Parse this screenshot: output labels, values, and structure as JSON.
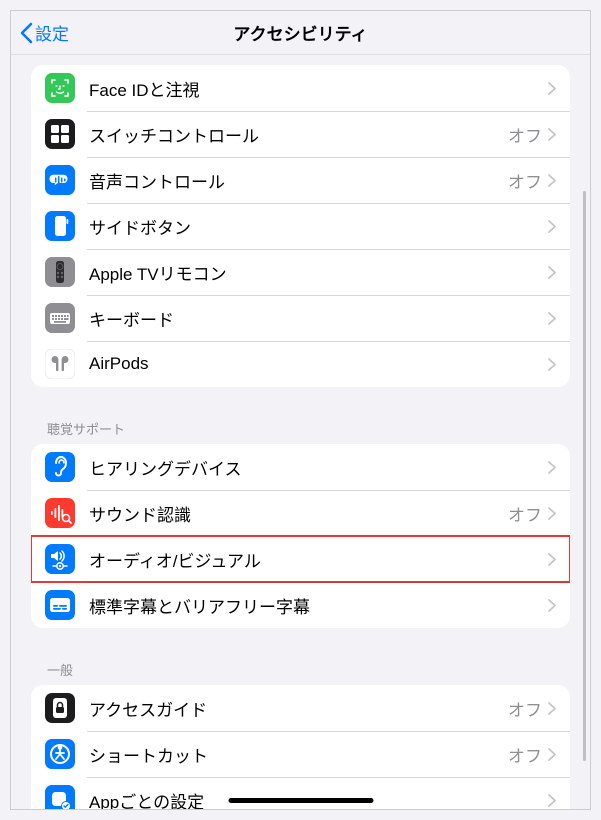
{
  "nav": {
    "back": "設定",
    "title": "アクセシビリティ"
  },
  "sections": [
    {
      "header": null,
      "rows": [
        {
          "id": "face-id",
          "icon": "face-id",
          "bg": "#34c759",
          "label": "Face IDと注視",
          "status": null
        },
        {
          "id": "switch-control",
          "icon": "switch-control",
          "bg": "#1c1c1e",
          "label": "スイッチコントロール",
          "status": "オフ"
        },
        {
          "id": "voice-control",
          "icon": "voice-control",
          "bg": "#007aff",
          "label": "音声コントロール",
          "status": "オフ"
        },
        {
          "id": "side-button",
          "icon": "side-button",
          "bg": "#007aff",
          "label": "サイドボタン",
          "status": null
        },
        {
          "id": "apple-tv",
          "icon": "apple-tv-remote",
          "bg": "#8e8e93",
          "label": "Apple TVリモコン",
          "status": null
        },
        {
          "id": "keyboard",
          "icon": "keyboard",
          "bg": "#8e8e93",
          "label": "キーボード",
          "status": null
        },
        {
          "id": "airpods",
          "icon": "airpods",
          "bg": "#ffffff",
          "label": "AirPods",
          "status": null
        }
      ]
    },
    {
      "header": "聴覚サポート",
      "rows": [
        {
          "id": "hearing-devices",
          "icon": "ear",
          "bg": "#007aff",
          "label": "ヒアリングデバイス",
          "status": null
        },
        {
          "id": "sound-recognition",
          "icon": "sound-recognition",
          "bg": "#ff3b30",
          "label": "サウンド認識",
          "status": "オフ"
        },
        {
          "id": "audio-visual",
          "icon": "audio-visual",
          "bg": "#007aff",
          "label": "オーディオ/ビジュアル",
          "status": null,
          "highlight": true
        },
        {
          "id": "subtitles",
          "icon": "subtitles",
          "bg": "#007aff",
          "label": "標準字幕とバリアフリー字幕",
          "status": null
        }
      ]
    },
    {
      "header": "一般",
      "rows": [
        {
          "id": "guided-access",
          "icon": "guided-access",
          "bg": "#1c1c1e",
          "label": "アクセスガイド",
          "status": "オフ"
        },
        {
          "id": "shortcut",
          "icon": "shortcut",
          "bg": "#007aff",
          "label": "ショートカット",
          "status": "オフ"
        },
        {
          "id": "per-app",
          "icon": "per-app",
          "bg": "#007aff",
          "label": "Appごとの設定",
          "status": null
        }
      ]
    }
  ]
}
